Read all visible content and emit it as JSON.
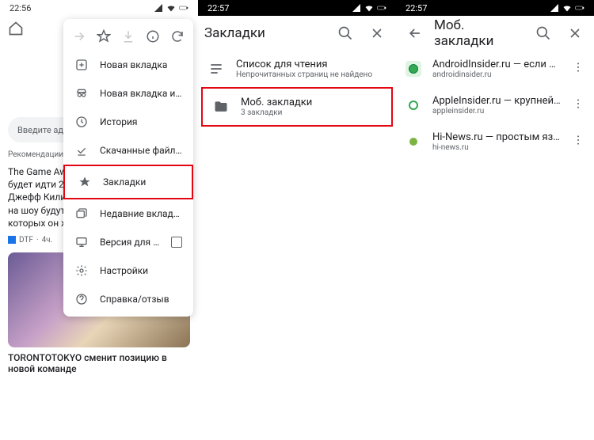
{
  "pane1": {
    "status": {
      "time": "22:56"
    },
    "search_placeholder": "Введите адр",
    "recommendations_label": "Рекомендации",
    "article1": {
      "text": "The Game Aw\nбудет идти 2,\nДжефф Кили\nна шоу будут\nкоторых он ж",
      "source": "DTF",
      "time": "4ч."
    },
    "article2": {
      "title": "TORONTOTOKYO сменит позицию в новой команде"
    },
    "menu": {
      "items": [
        {
          "label": "Новая вкладка"
        },
        {
          "label": "Новая вкладка инкогн..."
        },
        {
          "label": "История"
        },
        {
          "label": "Скачанные файлы"
        },
        {
          "label": "Закладки"
        },
        {
          "label": "Недавние вкладки"
        },
        {
          "label": "Версия для ПК"
        },
        {
          "label": "Настройки"
        },
        {
          "label": "Справка/отзыв"
        }
      ]
    }
  },
  "pane2": {
    "status": {
      "time": "22:57"
    },
    "title": "Закладки",
    "items": [
      {
        "title": "Список для чтения",
        "sub": "Непрочитанных страниц не найдено"
      },
      {
        "title": "Моб. закладки",
        "sub": "3 закладки"
      }
    ]
  },
  "pane3": {
    "status": {
      "time": "22:57"
    },
    "title": "Моб. закладки",
    "items": [
      {
        "title": "AndroidInsider.ru — если у вас сма...",
        "sub": "androidinsider.ru"
      },
      {
        "title": "AppleInsider.ru — крупнейший сайт...",
        "sub": "appleinsider.ru"
      },
      {
        "title": "Hi-News.ru — простым языком о н...",
        "sub": "hi-news.ru"
      }
    ]
  }
}
